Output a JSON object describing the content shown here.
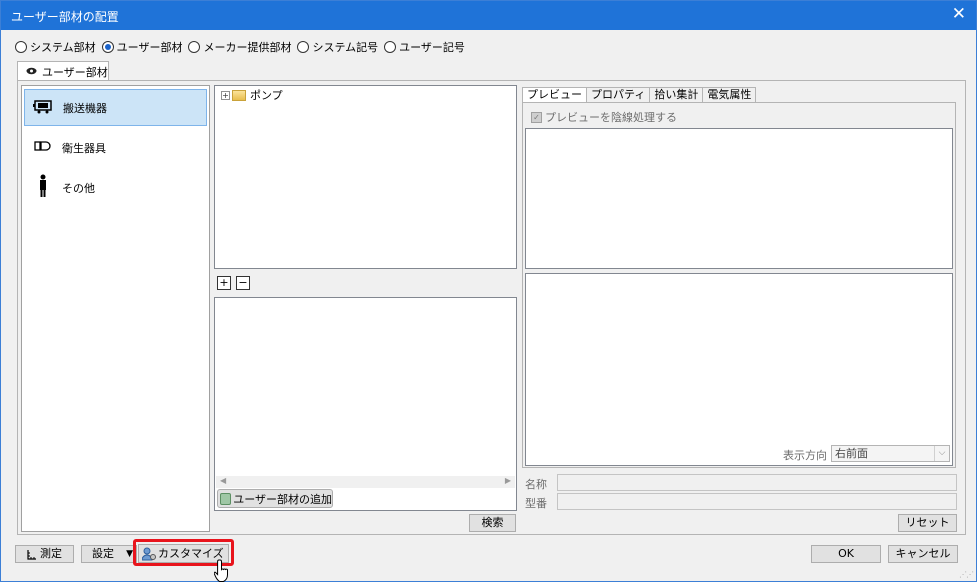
{
  "window": {
    "title": "ユーザー部材の配置",
    "close": "✕"
  },
  "radio_options": [
    {
      "label": "システム部材",
      "checked": false
    },
    {
      "label": "ユーザー部材",
      "checked": true
    },
    {
      "label": "メーカー提供部材",
      "checked": false
    },
    {
      "label": "システム記号",
      "checked": false
    },
    {
      "label": "ユーザー記号",
      "checked": false
    }
  ],
  "main_tab": {
    "label": "ユーザー部材"
  },
  "categories": [
    {
      "label": "搬送機器",
      "selected": true
    },
    {
      "label": "衛生器具",
      "selected": false
    },
    {
      "label": "その他",
      "selected": false
    }
  ],
  "tree": {
    "node_label": "ポンプ",
    "expander": "+"
  },
  "tree_controls": {
    "expand": "+",
    "collapse": "−"
  },
  "list": {
    "add_button": "ユーザー部材の追加"
  },
  "search_button": "検索",
  "right_tabs": [
    "プレビュー",
    "プロパティ",
    "拾い集計",
    "電気属性"
  ],
  "preview": {
    "hidden_line_checkbox": "プレビューを陰線処理する",
    "checked": true
  },
  "view_direction": {
    "label": "表示方向",
    "value": "右前面"
  },
  "fields": {
    "name_label": "名称",
    "model_label": "型番"
  },
  "reset_button": "リセット",
  "bottom_buttons": {
    "measure": "測定",
    "settings": "設定",
    "customize": "カスタマイズ"
  },
  "ok_button": "OK",
  "cancel_button": "キャンセル",
  "colors": {
    "titlebar": "#1f73d8",
    "highlight": "#e8141c",
    "selected_bg": "#cce4f7"
  }
}
